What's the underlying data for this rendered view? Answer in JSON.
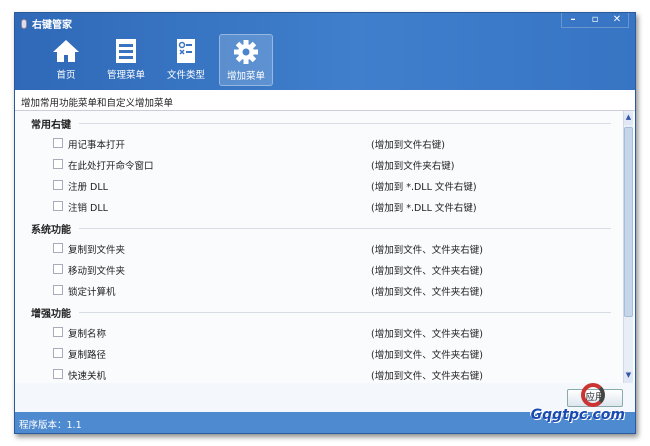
{
  "window": {
    "title": "右键管家",
    "controls": [
      "–",
      "▫",
      "✕"
    ]
  },
  "toolbar": [
    {
      "label": "首页",
      "icon": "home-icon"
    },
    {
      "label": "管理菜单",
      "icon": "list-icon"
    },
    {
      "label": "文件类型",
      "icon": "file-type-icon"
    },
    {
      "label": "增加菜单",
      "icon": "gear-icon",
      "active": true
    }
  ],
  "subtitle": "增加常用功能菜单和自定义增加菜单",
  "sections": [
    {
      "title": "常用右键",
      "items": [
        {
          "label": "用记事本打开",
          "note": "(增加到文件右键)"
        },
        {
          "label": "在此处打开命令窗口",
          "note": "(增加到文件夹右键)"
        },
        {
          "label": "注册 DLL",
          "note": "(增加到 *.DLL 文件右键)"
        },
        {
          "label": "注销 DLL",
          "note": "(增加到 *.DLL 文件右键)"
        }
      ]
    },
    {
      "title": "系统功能",
      "items": [
        {
          "label": "复制到文件夹",
          "note": "(增加到文件、文件夹右键)"
        },
        {
          "label": "移动到文件夹",
          "note": "(增加到文件、文件夹右键)"
        },
        {
          "label": "锁定计算机",
          "note": "(增加到文件、文件夹右键)"
        }
      ]
    },
    {
      "title": "增强功能",
      "items": [
        {
          "label": "复制名称",
          "note": "(增加到文件、文件夹右键)"
        },
        {
          "label": "复制路径",
          "note": "(增加到文件、文件夹右键)"
        },
        {
          "label": "快速关机",
          "note": "(增加到文件、文件夹右键)"
        }
      ]
    }
  ],
  "apply_label": "应用",
  "status": "程序版本：1.1",
  "watermark": "Gqgtpc.com"
}
